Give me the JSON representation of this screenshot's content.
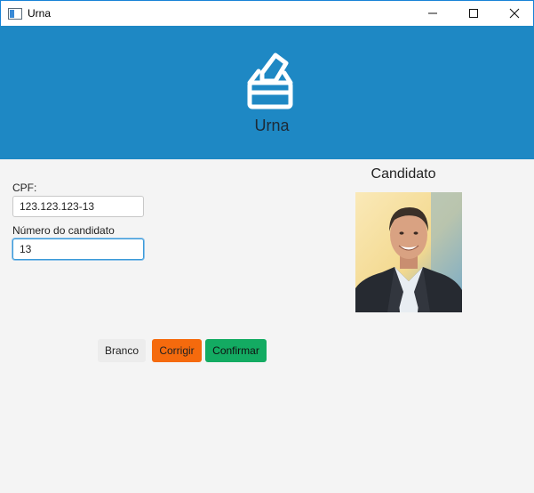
{
  "window": {
    "title": "Urna",
    "minimize_icon": "minimize-icon",
    "maximize_icon": "maximize-icon",
    "close_icon": "close-icon"
  },
  "header": {
    "icon": "ballot-box-icon",
    "title": "Urna",
    "background_color": "#1e88c4"
  },
  "form": {
    "cpf_label": "CPF:",
    "cpf_value": "123.123.123-13",
    "candidate_number_label": "Número do candidato",
    "candidate_number_value": "13"
  },
  "candidate": {
    "title": "Candidato",
    "photo": "candidate-photo"
  },
  "buttons": {
    "branco": "Branco",
    "corrigir": "Corrigir",
    "confirmar": "Confirmar",
    "corrigir_color": "#f56a0d",
    "confirmar_color": "#13ab62"
  }
}
